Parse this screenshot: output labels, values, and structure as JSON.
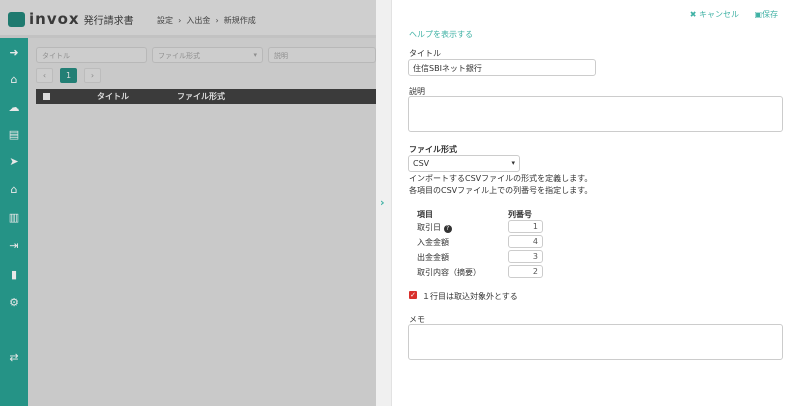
{
  "app": {
    "brand": "invox",
    "product": "発行請求書",
    "breadcrumb": [
      "設定",
      "入出金",
      "新規作成"
    ]
  },
  "list": {
    "filters": {
      "title_placeholder": "タイトル",
      "format_placeholder": "ファイル形式",
      "desc_placeholder": "説明"
    },
    "page": "1",
    "columns": [
      "タイトル",
      "ファイル形式"
    ]
  },
  "panel": {
    "cancel": "キャンセル",
    "save": "保存",
    "help": "ヘルプを表示する",
    "title_label": "タイトル",
    "title_value": "住信SBIネット銀行",
    "desc_label": "説明",
    "format_label": "ファイル形式",
    "format_value": "CSV",
    "info1": "インポートするCSVファイルの形式を定義します。",
    "info2": "各項目のCSVファイル上での列番号を指定します。",
    "col_item": "項目",
    "col_num": "列番号",
    "mappings": [
      {
        "label": "取引日",
        "value": "1"
      },
      {
        "label": "入金金額",
        "value": "4"
      },
      {
        "label": "出金金額",
        "value": "3"
      },
      {
        "label": "取引内容（摘要）",
        "value": "2"
      }
    ],
    "skip_first": "１行目は取込対象外とする",
    "skip_checked": true,
    "memo_label": "メモ"
  }
}
